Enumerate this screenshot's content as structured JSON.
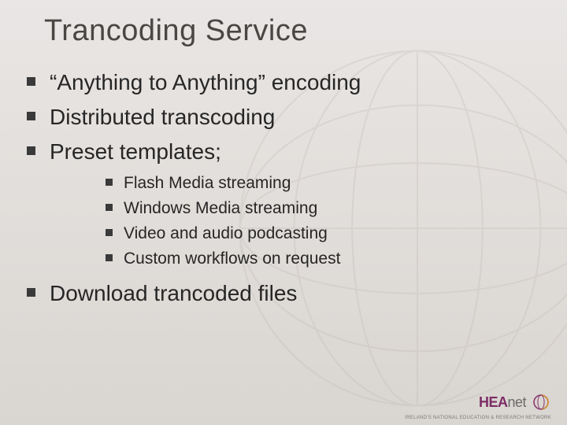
{
  "title": "Trancoding Service",
  "bullets": {
    "b0": "“Anything to Anything” encoding",
    "b1": "Distributed transcoding",
    "b2": "Preset templates;",
    "b3": "Download trancoded files"
  },
  "sub": {
    "s0": "Flash Media streaming",
    "s1": "Windows Media streaming",
    "s2": "Video and audio podcasting",
    "s3": "Custom workflows on request"
  },
  "logo": {
    "brand": "HEA",
    "suffix": "net",
    "tagline": "IRELAND'S NATIONAL EDUCATION & RESEARCH NETWORK"
  }
}
